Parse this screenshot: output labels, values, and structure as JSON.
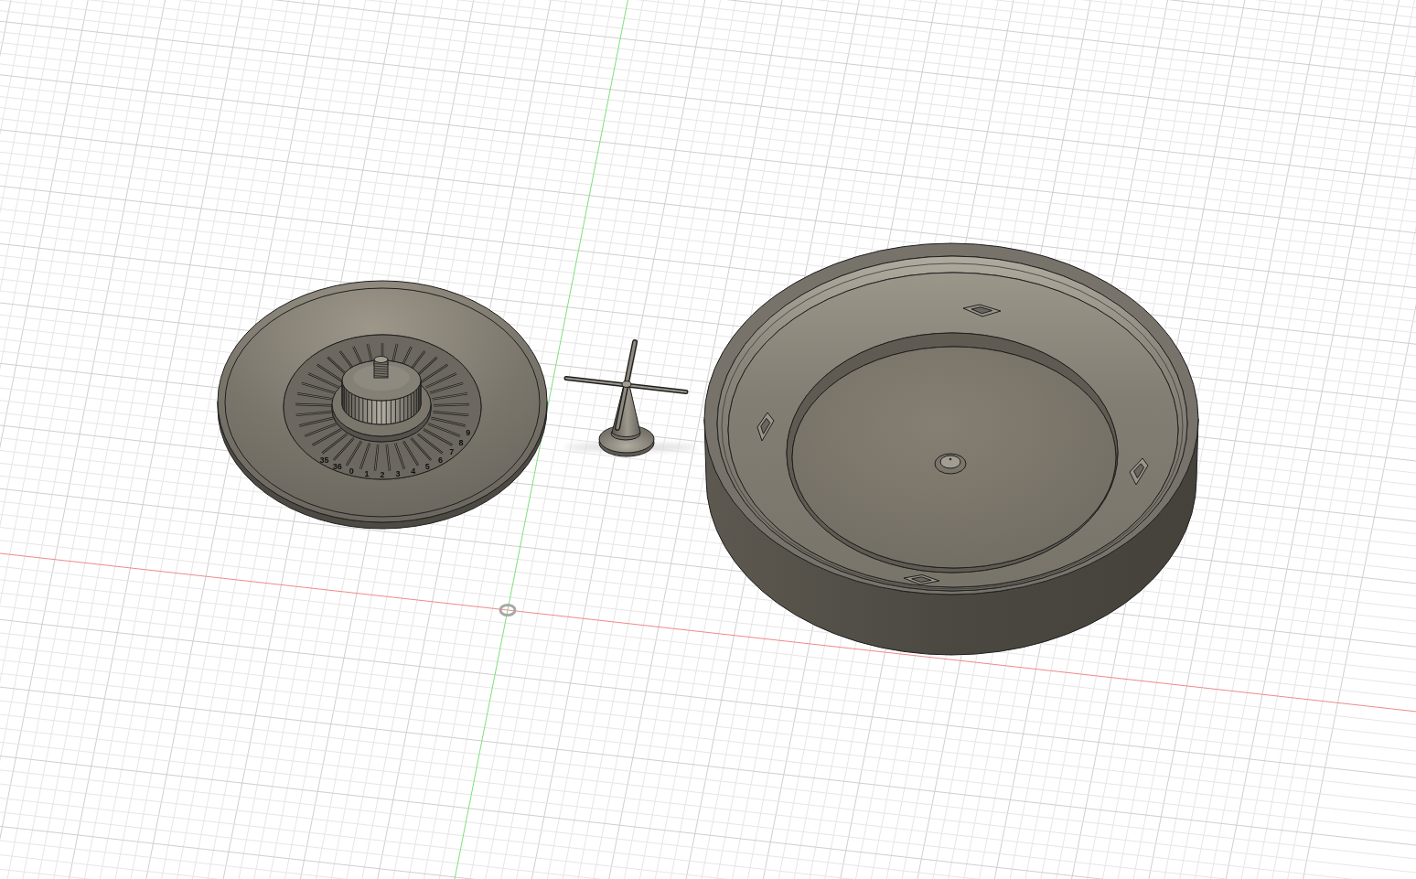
{
  "viewport": {
    "bodies": [
      {
        "kind": "wheel",
        "dial_numbers": [
          "35",
          "36",
          "0",
          "1",
          "2",
          "3",
          "4",
          "5",
          "6",
          "7",
          "8",
          "9"
        ]
      },
      {
        "kind": "spindle"
      },
      {
        "kind": "bowl"
      }
    ]
  }
}
